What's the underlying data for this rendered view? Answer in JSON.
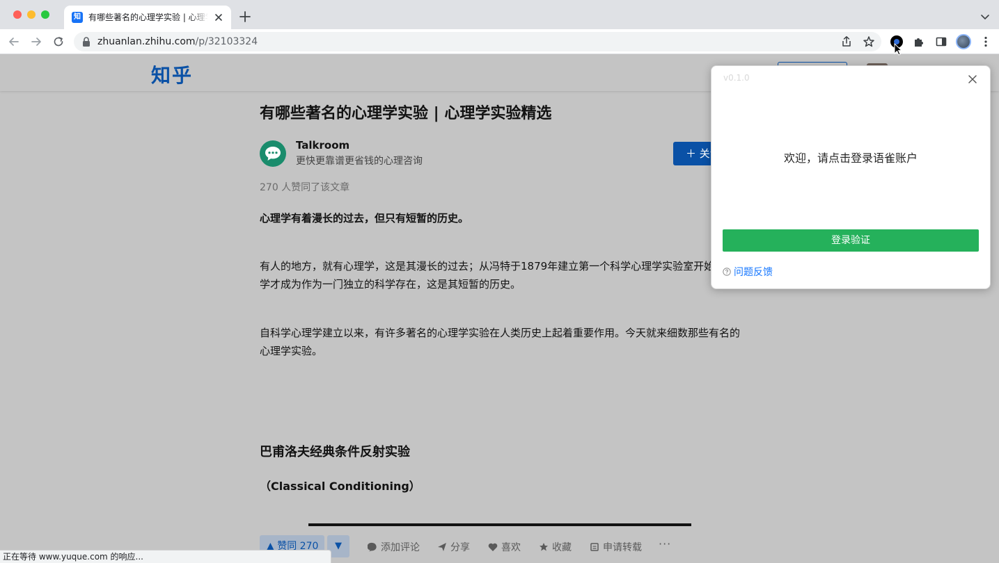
{
  "browser": {
    "tab_title": "有哪些著名的心理学实验 | 心理学实验精选",
    "tab_favicon_text": "知",
    "url_host": "zhuanlan.zhihu.com",
    "url_path": "/p/32103324",
    "status_text": "正在等待 www.yuque.com 的响应..."
  },
  "site": {
    "logo": "知乎"
  },
  "article": {
    "title": "有哪些著名的心理学实验 | 心理学实验精选",
    "author_name": "Talkroom",
    "author_desc": "更快更靠谱更省钱的心理咨询",
    "follow_label": "＋ 关注",
    "voters": "270 人赞同了该文章",
    "p1": "心理学有着漫长的过去，但只有短暂的历史。",
    "p2": "有人的地方，就有心理学，这是其漫长的过去；从冯特于1879年建立第一个科学心理学实验室开始，心理学才成为作为一门独立的科学存在，这是其短暂的历史。",
    "p3": "自科学心理学建立以来，有许多著名的心理学实验在人类历史上起着重要作用。今天就来细数那些有名的心理学实验。",
    "h2": "巴甫洛夫经典条件反射实验",
    "h3": "（Classical Conditioning）"
  },
  "actions": {
    "vote": "▲ 赞同 270",
    "downvote": "▼",
    "comment": "添加评论",
    "share": "分享",
    "like": "喜欢",
    "collect": "收藏",
    "repost": "申请转载",
    "more": "···"
  },
  "popup": {
    "version": "v0.1.0",
    "welcome": "欢迎，请点击登录语雀账户",
    "login_button": "登录验证",
    "feedback": "问题反馈"
  },
  "colors": {
    "zhihu_blue": "#0a51a6",
    "yuque_green": "#25b15b",
    "link_blue": "#1677ff"
  },
  "icons": [
    "back-icon",
    "forward-icon",
    "reload-icon",
    "lock-icon",
    "share-icon",
    "star-icon",
    "yuque-extension-icon",
    "puzzle-icon",
    "side-panel-icon",
    "kebab-menu-icon",
    "close-icon",
    "question-circle-icon"
  ]
}
